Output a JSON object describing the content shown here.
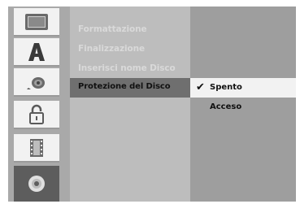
{
  "sidebar": {
    "icons": [
      {
        "name": "tv-screen-icon"
      },
      {
        "name": "letter-a-icon"
      },
      {
        "name": "speaker-sound-icon"
      },
      {
        "name": "lock-icon"
      },
      {
        "name": "film-strip-icon"
      },
      {
        "name": "disc-icon",
        "active": true
      }
    ]
  },
  "menu": {
    "items": [
      {
        "label": "Formattazione"
      },
      {
        "label": "Finalizzazione"
      },
      {
        "label": "Inserisci nome Disco"
      },
      {
        "label": "Protezione del Disco",
        "selected": true
      }
    ]
  },
  "options": {
    "items": [
      {
        "label": "Spento",
        "checked": true
      },
      {
        "label": "Acceso"
      }
    ]
  },
  "icons": {
    "checkmark": "✔"
  }
}
